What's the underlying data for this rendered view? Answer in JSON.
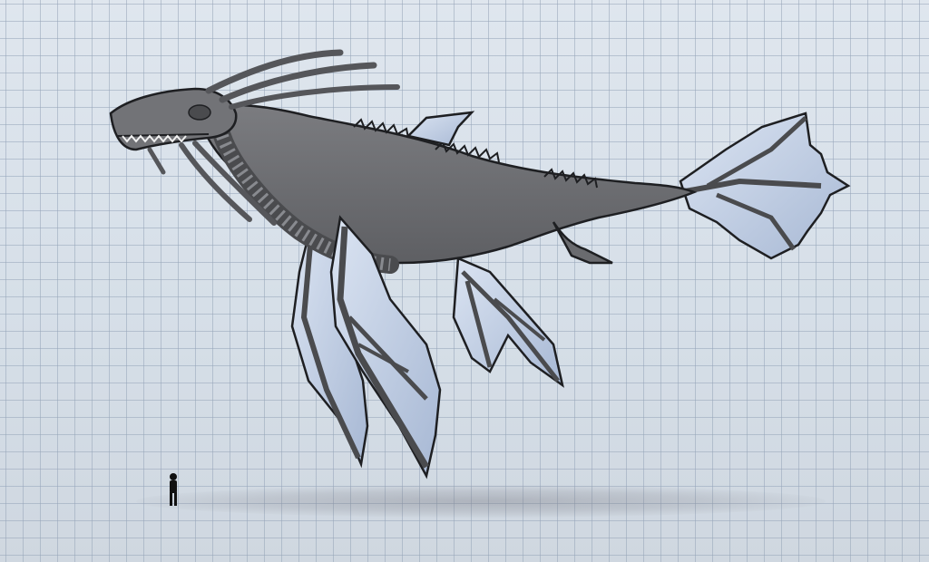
{
  "scene": {
    "subject": "",
    "colors": {
      "background": "#dde4ec",
      "grid": "#9aa8ba",
      "skin": "#6f7073",
      "skin_dark": "#4a4b4e",
      "fin": "#c9d6ea",
      "fin_shade": "#a9b9d3",
      "outline": "#1e1f22",
      "human": "#111111"
    }
  }
}
